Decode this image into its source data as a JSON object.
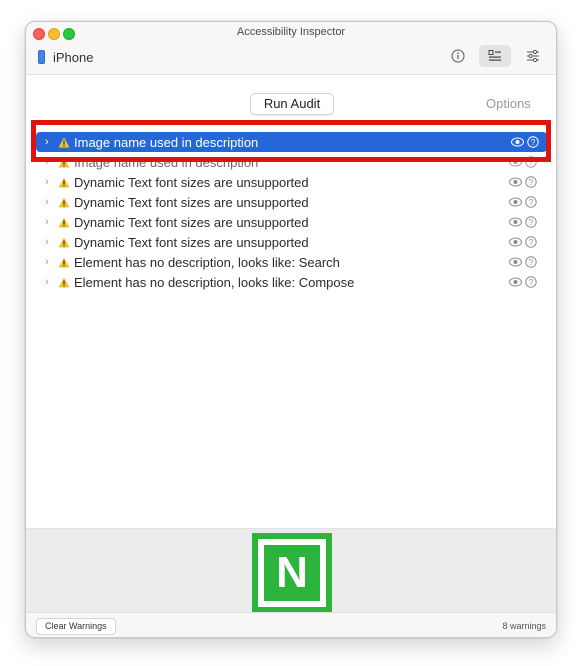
{
  "window": {
    "title": "Accessibility Inspector"
  },
  "device": {
    "name": "iPhone"
  },
  "toolbar": {
    "info_icon": "info-icon",
    "audit_icon": "audit-list-icon",
    "settings_icon": "sliders-icon"
  },
  "audit": {
    "run_label": "Run Audit",
    "options_label": "Options"
  },
  "warnings": [
    {
      "text": "Image name used in description",
      "selected": true
    },
    {
      "text": "Image name used in description",
      "selected": false
    },
    {
      "text": "Dynamic Text font sizes are unsupported",
      "selected": false
    },
    {
      "text": "Dynamic Text font sizes are unsupported",
      "selected": false
    },
    {
      "text": "Dynamic Text font sizes are unsupported",
      "selected": false
    },
    {
      "text": "Dynamic Text font sizes are unsupported",
      "selected": false
    },
    {
      "text": "Element has no description, looks like: Search",
      "selected": false
    },
    {
      "text": "Element has no description, looks like: Compose",
      "selected": false
    }
  ],
  "preview": {
    "glyph": "N"
  },
  "footer": {
    "clear_label": "Clear Warnings",
    "count_label": "8 warnings"
  },
  "colors": {
    "selection": "#2567d8",
    "highlight": "#e0140f",
    "brand_green": "#2db43c"
  }
}
